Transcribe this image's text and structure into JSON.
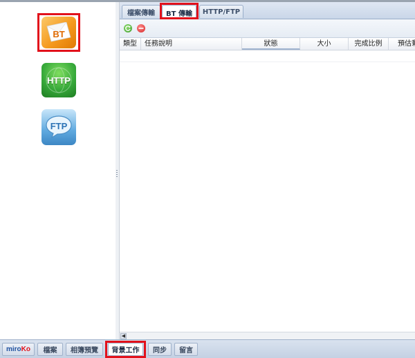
{
  "left_panel": {
    "items": [
      {
        "name": "bt",
        "label": "BT",
        "selected": true
      },
      {
        "name": "http",
        "label": "HTTP",
        "selected": false
      },
      {
        "name": "ftp",
        "label": "FTP",
        "selected": false
      }
    ]
  },
  "tabs": [
    {
      "label": "檔案傳輸",
      "active": false
    },
    {
      "label": "BT 傳輸",
      "active": true
    },
    {
      "label": "HTTP/FTP",
      "active": false
    }
  ],
  "toolbar": {
    "refresh_icon": "refresh-icon",
    "remove_icon": "remove-icon"
  },
  "columns": [
    "類型",
    "任務說明",
    "狀態",
    "大小",
    "完成比例",
    "預估剩"
  ],
  "bottom_tabs": [
    {
      "label": "miroKo",
      "active": false
    },
    {
      "label": "檔案",
      "active": false
    },
    {
      "label": "相簿預覽",
      "active": false
    },
    {
      "label": "背景工作",
      "active": true
    },
    {
      "label": "同步",
      "active": false
    },
    {
      "label": "留言",
      "active": false
    }
  ],
  "colors": {
    "highlight": "#e2111b",
    "bt_orange": "#f59a1e",
    "http_green": "#37a93a",
    "ftp_blue": "#5fa9df",
    "brand_blue": "#1d4f9e",
    "brand_red": "#e2111b"
  }
}
